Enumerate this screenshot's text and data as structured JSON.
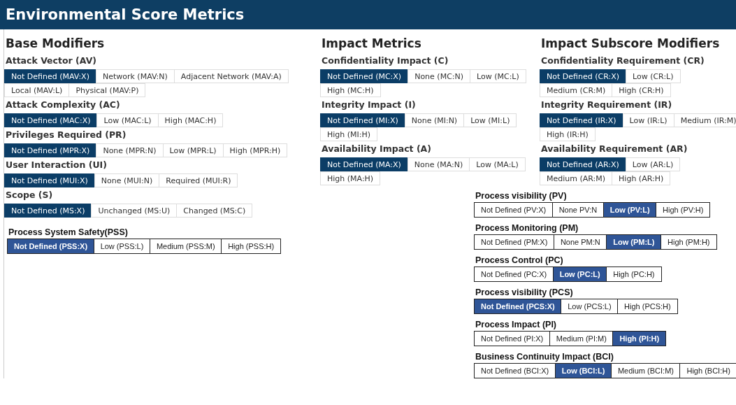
{
  "header": {
    "title": "Environmental Score Metrics"
  },
  "columns": [
    {
      "heading": "Base Modifiers",
      "metrics": [
        {
          "label": "Attack Vector (AV)",
          "rows": [
            [
              {
                "text": "Not Defined (MAV:X)",
                "selected": true
              },
              {
                "text": "Network (MAV:N)",
                "selected": false
              },
              {
                "text": "Adjacent Network (MAV:A)",
                "selected": false
              }
            ],
            [
              {
                "text": "Local (MAV:L)",
                "selected": false
              },
              {
                "text": "Physical (MAV:P)",
                "selected": false
              }
            ]
          ]
        },
        {
          "label": "Attack Complexity (AC)",
          "rows": [
            [
              {
                "text": "Not Defined (MAC:X)",
                "selected": true
              },
              {
                "text": "Low (MAC:L)",
                "selected": false
              },
              {
                "text": "High (MAC:H)",
                "selected": false
              }
            ]
          ]
        },
        {
          "label": "Privileges Required (PR)",
          "rows": [
            [
              {
                "text": "Not Defined (MPR:X)",
                "selected": true
              },
              {
                "text": "None (MPR:N)",
                "selected": false
              },
              {
                "text": "Low (MPR:L)",
                "selected": false
              },
              {
                "text": "High (MPR:H)",
                "selected": false
              }
            ]
          ]
        },
        {
          "label": "User Interaction (UI)",
          "rows": [
            [
              {
                "text": "Not Defined (MUI:X)",
                "selected": true
              },
              {
                "text": "None (MUI:N)",
                "selected": false
              },
              {
                "text": "Required (MUI:R)",
                "selected": false
              }
            ]
          ]
        },
        {
          "label": "Scope (S)",
          "rows": [
            [
              {
                "text": "Not Defined (MS:X)",
                "selected": true
              },
              {
                "text": "Unchanged (MS:U)",
                "selected": false
              },
              {
                "text": "Changed (MS:C)",
                "selected": false
              }
            ]
          ]
        }
      ]
    },
    {
      "heading": "Impact Metrics",
      "metrics": [
        {
          "label": "Confidentiality Impact (C)",
          "rows": [
            [
              {
                "text": "Not Defined (MC:X)",
                "selected": true
              },
              {
                "text": "None (MC:N)",
                "selected": false
              },
              {
                "text": "Low (MC:L)",
                "selected": false
              }
            ],
            [
              {
                "text": "High (MC:H)",
                "selected": false
              }
            ]
          ]
        },
        {
          "label": "Integrity Impact (I)",
          "rows": [
            [
              {
                "text": "Not Defined (MI:X)",
                "selected": true
              },
              {
                "text": "None (MI:N)",
                "selected": false
              },
              {
                "text": "Low (MI:L)",
                "selected": false
              }
            ],
            [
              {
                "text": "High (MI:H)",
                "selected": false
              }
            ]
          ]
        },
        {
          "label": "Availability Impact (A)",
          "rows": [
            [
              {
                "text": "Not Defined (MA:X)",
                "selected": true
              },
              {
                "text": "None (MA:N)",
                "selected": false
              },
              {
                "text": "Low (MA:L)",
                "selected": false
              }
            ],
            [
              {
                "text": "High (MA:H)",
                "selected": false
              }
            ]
          ]
        }
      ]
    },
    {
      "heading": "Impact Subscore Modifiers",
      "metrics": [
        {
          "label": "Confidentiality Requirement (CR)",
          "rows": [
            [
              {
                "text": "Not Defined (CR:X)",
                "selected": true
              },
              {
                "text": "Low (CR:L)",
                "selected": false
              }
            ],
            [
              {
                "text": "Medium (CR:M)",
                "selected": false
              },
              {
                "text": "High (CR:H)",
                "selected": false
              }
            ]
          ]
        },
        {
          "label": "Integrity Requirement (IR)",
          "rows": [
            [
              {
                "text": "Not Defined (IR:X)",
                "selected": true
              },
              {
                "text": "Low (IR:L)",
                "selected": false
              },
              {
                "text": "Medium (IR:M)",
                "selected": false
              }
            ],
            [
              {
                "text": "High (IR:H)",
                "selected": false
              }
            ]
          ]
        },
        {
          "label": "Availability Requirement (AR)",
          "rows": [
            [
              {
                "text": "Not Defined (AR:X)",
                "selected": true
              },
              {
                "text": "Low (AR:L)",
                "selected": false
              }
            ],
            [
              {
                "text": "Medium (AR:M)",
                "selected": false
              },
              {
                "text": "High (AR:H)",
                "selected": false
              }
            ]
          ]
        }
      ]
    }
  ],
  "process_system_safety": {
    "label": "Process System Safety(PSS)",
    "options": [
      {
        "text": "Not Defined (PSS:X)",
        "selected": true
      },
      {
        "text": "Low (PSS:L)",
        "selected": false
      },
      {
        "text": "Medium (PSS:M)",
        "selected": false
      },
      {
        "text": "High (PSS:H)",
        "selected": false
      }
    ]
  },
  "process_metrics": [
    {
      "label": "Process visibility (PV)",
      "options": [
        {
          "text": "Not Defined (PV:X)",
          "selected": false
        },
        {
          "text": "None PV:N",
          "selected": false
        },
        {
          "text": "Low (PV:L)",
          "selected": true
        },
        {
          "text": "High (PV:H)",
          "selected": false
        }
      ]
    },
    {
      "label": "Process Monitoring (PM)",
      "options": [
        {
          "text": "Not Defined (PM:X)",
          "selected": false
        },
        {
          "text": "None PM:N",
          "selected": false
        },
        {
          "text": "Low (PM:L)",
          "selected": true
        },
        {
          "text": "High (PM:H)",
          "selected": false
        }
      ]
    },
    {
      "label": "Process Control (PC)",
      "options": [
        {
          "text": "Not Defined (PC:X)",
          "selected": false
        },
        {
          "text": "Low (PC:L)",
          "selected": true
        },
        {
          "text": "High (PC:H)",
          "selected": false
        }
      ]
    },
    {
      "label": "Process visibility (PCS)",
      "options": [
        {
          "text": "Not Defined (PCS:X)",
          "selected": true
        },
        {
          "text": "Low (PCS:L)",
          "selected": false
        },
        {
          "text": "High (PCS:H)",
          "selected": false
        }
      ]
    },
    {
      "label": "Process Impact (PI)",
      "options": [
        {
          "text": "Not Defined (PI:X)",
          "selected": false
        },
        {
          "text": "Medium (PI:M)",
          "selected": false
        },
        {
          "text": "High (PI:H)",
          "selected": true
        }
      ]
    },
    {
      "label": "Business Continuity Impact (BCI)",
      "options": [
        {
          "text": "Not Defined (BCI:X)",
          "selected": false
        },
        {
          "text": "Low (BCI:L)",
          "selected": true
        },
        {
          "text": "Medium (BCI:M)",
          "selected": false
        },
        {
          "text": "High (BCI:H)",
          "selected": false
        }
      ]
    }
  ]
}
